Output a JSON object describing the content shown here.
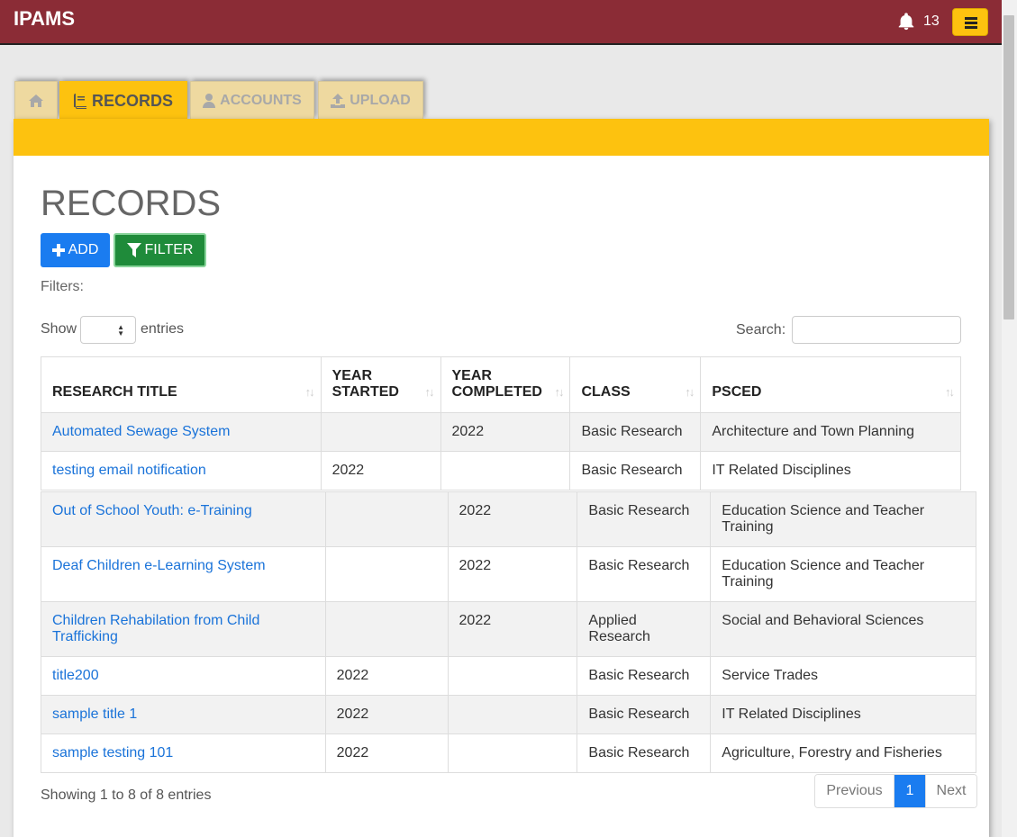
{
  "app": {
    "title": "IPAMS",
    "notification_count": "13"
  },
  "tabs": [
    {
      "label": "",
      "icon": "home-icon"
    },
    {
      "label": "RECORDS",
      "icon": "book-icon",
      "active": true
    },
    {
      "label": "ACCOUNTS",
      "icon": "user-icon"
    },
    {
      "label": "UPLOAD",
      "icon": "upload-icon"
    }
  ],
  "page": {
    "title": "RECORDS",
    "add_label": "ADD",
    "filter_label": "FILTER",
    "filters_label": "Filters:"
  },
  "table_controls": {
    "show_label": "Show",
    "entries_label": "entries",
    "search_label": "Search:"
  },
  "table": {
    "headers": [
      {
        "line1": "RESEARCH TITLE",
        "line2": ""
      },
      {
        "line1": "YEAR",
        "line2": "STARTED"
      },
      {
        "line1": "YEAR",
        "line2": "COMPLETED"
      },
      {
        "line1": "CLASS",
        "line2": ""
      },
      {
        "line1": "PSCED",
        "line2": ""
      }
    ],
    "rows": [
      {
        "title": "Automated Sewage System",
        "year_started": "",
        "year_completed": "2022",
        "class": "Basic Research",
        "psced": "Architecture and Town Planning"
      },
      {
        "title": "testing email notification",
        "year_started": "2022",
        "year_completed": "",
        "class": "Basic Research",
        "psced": "IT Related Disciplines"
      },
      {
        "title": "Out of School Youth: e-Training",
        "year_started": "",
        "year_completed": "2022",
        "class": "Basic Research",
        "psced": "Education Science and Teacher Training"
      },
      {
        "title": "Deaf Children e-Learning System",
        "year_started": "",
        "year_completed": "2022",
        "class": "Basic Research",
        "psced": "Education Science and Teacher Training"
      },
      {
        "title": "Children Rehabilation from Child Trafficking",
        "year_started": "",
        "year_completed": "2022",
        "class": "Applied Research",
        "psced": "Social and Behavioral Sciences"
      },
      {
        "title": "title200",
        "year_started": "2022",
        "year_completed": "",
        "class": "Basic Research",
        "psced": "Service Trades"
      },
      {
        "title": "sample title 1",
        "year_started": "2022",
        "year_completed": "",
        "class": "Basic Research",
        "psced": "IT Related Disciplines"
      },
      {
        "title": "sample testing 101",
        "year_started": "2022",
        "year_completed": "",
        "class": "Basic Research",
        "psced": "Agriculture, Forestry and Fisheries"
      }
    ]
  },
  "footer": {
    "info": "Showing 1 to 8 of 8 entries",
    "prev_label": "Previous",
    "current_page": "1",
    "next_label": "Next"
  },
  "colors": {
    "navbar": "#8b2c36",
    "accent": "#fdc20f",
    "primary": "#1a7cf0",
    "success": "#1f8b3a",
    "link": "#1a73d9"
  }
}
